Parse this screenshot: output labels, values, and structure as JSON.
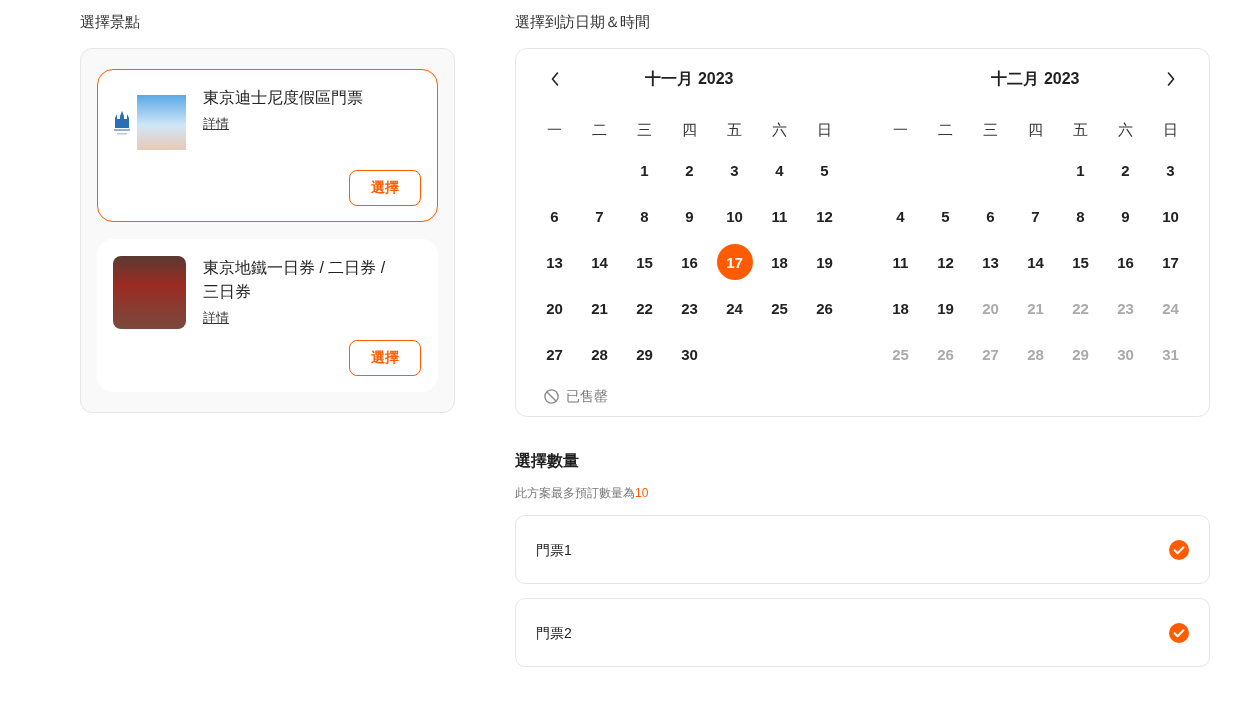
{
  "attractions": {
    "title": "選擇景點",
    "items": [
      {
        "name": "東京迪士尼度假區門票",
        "thumbnail": {
          "kind": "logo_photo"
        },
        "details_link": "詳情",
        "button": "選擇",
        "selected": true
      },
      {
        "name": "東京地鐵一日券 / 二日券 / 三日券",
        "thumbnail": {
          "kind": "photo"
        },
        "details_link": "詳情",
        "button": "選擇",
        "selected": false
      }
    ]
  },
  "date_picker": {
    "title": "選擇到訪日期＆時間",
    "months": [
      {
        "title": "十一月 2023",
        "weekdays": [
          "一",
          "二",
          "三",
          "四",
          "五",
          "六",
          "日"
        ],
        "days": [
          {
            "kind": "blank"
          },
          {
            "kind": "blank"
          },
          {
            "kind": "day",
            "label": "1",
            "selected": false,
            "disabled": false
          },
          {
            "kind": "day",
            "label": "2",
            "selected": false,
            "disabled": false
          },
          {
            "kind": "day",
            "label": "3",
            "selected": false,
            "disabled": false
          },
          {
            "kind": "day",
            "label": "4",
            "selected": false,
            "disabled": false
          },
          {
            "kind": "day",
            "label": "5",
            "selected": false,
            "disabled": false
          },
          {
            "kind": "day",
            "label": "6",
            "selected": false,
            "disabled": false
          },
          {
            "kind": "day",
            "label": "7",
            "selected": false,
            "disabled": false
          },
          {
            "kind": "day",
            "label": "8",
            "selected": false,
            "disabled": false
          },
          {
            "kind": "day",
            "label": "9",
            "selected": false,
            "disabled": false
          },
          {
            "kind": "day",
            "label": "10",
            "selected": false,
            "disabled": false
          },
          {
            "kind": "day",
            "label": "11",
            "selected": false,
            "disabled": false
          },
          {
            "kind": "day",
            "label": "12",
            "selected": false,
            "disabled": false
          },
          {
            "kind": "day",
            "label": "13",
            "selected": false,
            "disabled": false
          },
          {
            "kind": "day",
            "label": "14",
            "selected": false,
            "disabled": false
          },
          {
            "kind": "day",
            "label": "15",
            "selected": false,
            "disabled": false
          },
          {
            "kind": "day",
            "label": "16",
            "selected": false,
            "disabled": false
          },
          {
            "kind": "day",
            "label": "17",
            "selected": true,
            "disabled": false
          },
          {
            "kind": "day",
            "label": "18",
            "selected": false,
            "disabled": false
          },
          {
            "kind": "day",
            "label": "19",
            "selected": false,
            "disabled": false
          },
          {
            "kind": "day",
            "label": "20",
            "selected": false,
            "disabled": false
          },
          {
            "kind": "day",
            "label": "21",
            "selected": false,
            "disabled": false
          },
          {
            "kind": "day",
            "label": "22",
            "selected": false,
            "disabled": false
          },
          {
            "kind": "day",
            "label": "23",
            "selected": false,
            "disabled": false
          },
          {
            "kind": "day",
            "label": "24",
            "selected": false,
            "disabled": false
          },
          {
            "kind": "day",
            "label": "25",
            "selected": false,
            "disabled": false
          },
          {
            "kind": "day",
            "label": "26",
            "selected": false,
            "disabled": false
          },
          {
            "kind": "day",
            "label": "27",
            "selected": false,
            "disabled": false
          },
          {
            "kind": "day",
            "label": "28",
            "selected": false,
            "disabled": false
          },
          {
            "kind": "day",
            "label": "29",
            "selected": false,
            "disabled": false
          },
          {
            "kind": "day",
            "label": "30",
            "selected": false,
            "disabled": false
          }
        ]
      },
      {
        "title": "十二月 2023",
        "weekdays": [
          "一",
          "二",
          "三",
          "四",
          "五",
          "六",
          "日"
        ],
        "days": [
          {
            "kind": "blank"
          },
          {
            "kind": "blank"
          },
          {
            "kind": "blank"
          },
          {
            "kind": "blank"
          },
          {
            "kind": "day",
            "label": "1",
            "selected": false,
            "disabled": false
          },
          {
            "kind": "day",
            "label": "2",
            "selected": false,
            "disabled": false
          },
          {
            "kind": "day",
            "label": "3",
            "selected": false,
            "disabled": false
          },
          {
            "kind": "day",
            "label": "4",
            "selected": false,
            "disabled": false
          },
          {
            "kind": "day",
            "label": "5",
            "selected": false,
            "disabled": false
          },
          {
            "kind": "day",
            "label": "6",
            "selected": false,
            "disabled": false
          },
          {
            "kind": "day",
            "label": "7",
            "selected": false,
            "disabled": false
          },
          {
            "kind": "day",
            "label": "8",
            "selected": false,
            "disabled": false
          },
          {
            "kind": "day",
            "label": "9",
            "selected": false,
            "disabled": false
          },
          {
            "kind": "day",
            "label": "10",
            "selected": false,
            "disabled": false
          },
          {
            "kind": "day",
            "label": "11",
            "selected": false,
            "disabled": false
          },
          {
            "kind": "day",
            "label": "12",
            "selected": false,
            "disabled": false
          },
          {
            "kind": "day",
            "label": "13",
            "selected": false,
            "disabled": false
          },
          {
            "kind": "day",
            "label": "14",
            "selected": false,
            "disabled": false
          },
          {
            "kind": "day",
            "label": "15",
            "selected": false,
            "disabled": false
          },
          {
            "kind": "day",
            "label": "16",
            "selected": false,
            "disabled": false
          },
          {
            "kind": "day",
            "label": "17",
            "selected": false,
            "disabled": false
          },
          {
            "kind": "day",
            "label": "18",
            "selected": false,
            "disabled": false
          },
          {
            "kind": "day",
            "label": "19",
            "selected": false,
            "disabled": false
          },
          {
            "kind": "day",
            "label": "20",
            "selected": false,
            "disabled": true
          },
          {
            "kind": "day",
            "label": "21",
            "selected": false,
            "disabled": true
          },
          {
            "kind": "day",
            "label": "22",
            "selected": false,
            "disabled": true
          },
          {
            "kind": "day",
            "label": "23",
            "selected": false,
            "disabled": true
          },
          {
            "kind": "day",
            "label": "24",
            "selected": false,
            "disabled": true
          },
          {
            "kind": "day",
            "label": "25",
            "selected": false,
            "disabled": true
          },
          {
            "kind": "day",
            "label": "26",
            "selected": false,
            "disabled": true
          },
          {
            "kind": "day",
            "label": "27",
            "selected": false,
            "disabled": true
          },
          {
            "kind": "day",
            "label": "28",
            "selected": false,
            "disabled": true
          },
          {
            "kind": "day",
            "label": "29",
            "selected": false,
            "disabled": true
          },
          {
            "kind": "day",
            "label": "30",
            "selected": false,
            "disabled": true
          },
          {
            "kind": "day",
            "label": "31",
            "selected": false,
            "disabled": true
          }
        ]
      }
    ],
    "legend": {
      "label": "已售罄"
    }
  },
  "quantity": {
    "title": "選擇數量",
    "note": "此方案最多預訂數量為",
    "max_quantity": "10",
    "tickets": [
      {
        "label": "門票1",
        "checked": true
      },
      {
        "label": "門票2",
        "checked": true
      }
    ]
  }
}
